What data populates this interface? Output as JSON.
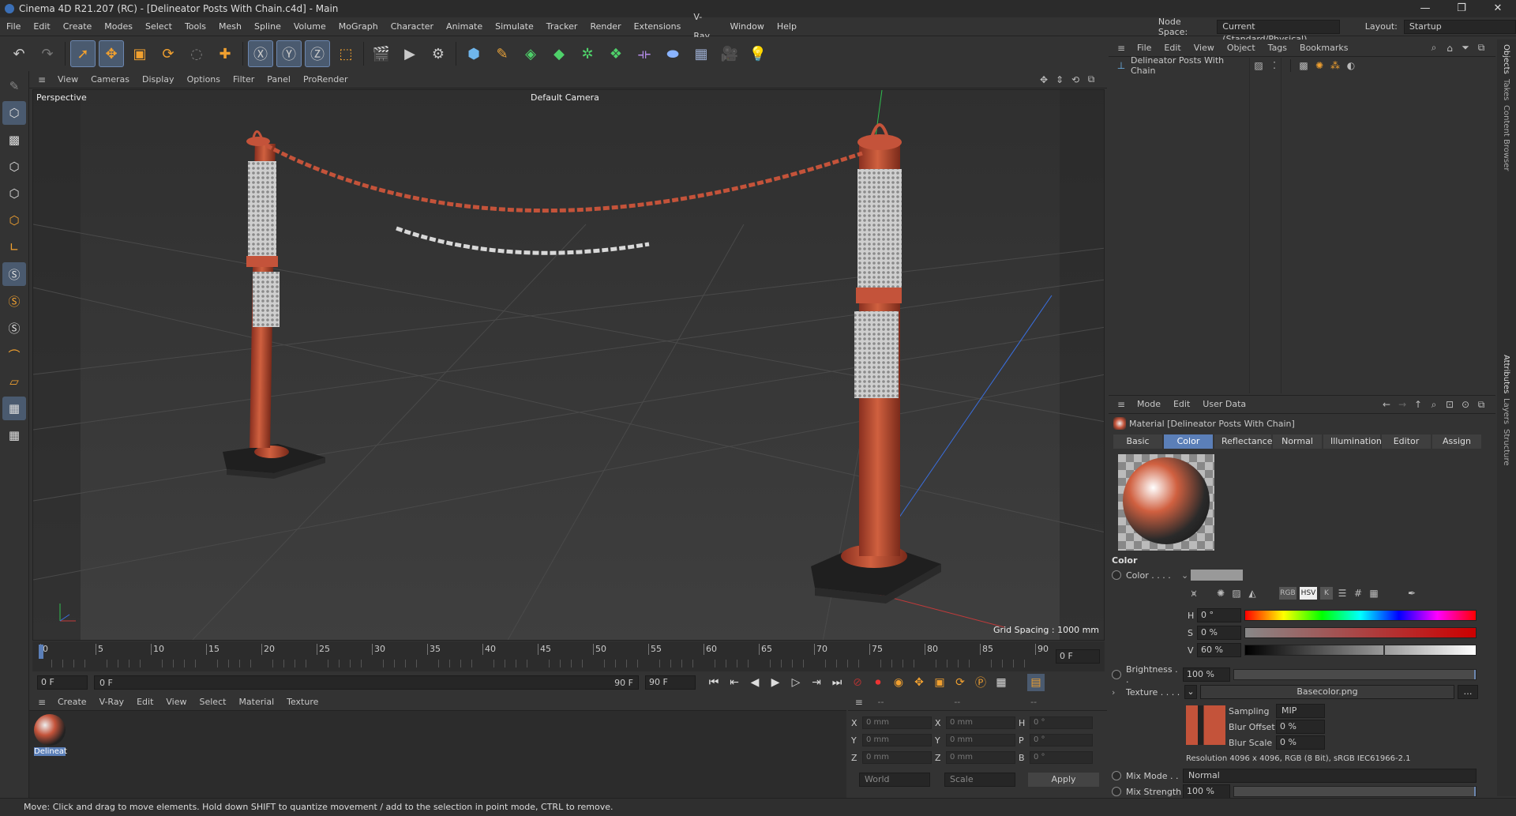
{
  "window": {
    "title": "Cinema 4D R21.207 (RC) - [Delineator Posts With Chain.c4d] - Main",
    "controls": [
      "—",
      "❐",
      "✕"
    ]
  },
  "menubar": {
    "items": [
      "File",
      "Edit",
      "Create",
      "Modes",
      "Select",
      "Tools",
      "Mesh",
      "Spline",
      "Volume",
      "MoGraph",
      "Character",
      "Animate",
      "Simulate",
      "Tracker",
      "Render",
      "Extensions",
      "V-Ray",
      "Window",
      "Help"
    ],
    "node_space_label": "Node Space:",
    "node_space_value": "Current (Standard/Physical)",
    "layout_label": "Layout:",
    "layout_value": "Startup"
  },
  "viewport": {
    "menu": [
      "View",
      "Cameras",
      "Display",
      "Options",
      "Filter",
      "Panel",
      "ProRender"
    ],
    "label": "Perspective",
    "camera": "Default Camera",
    "grid_spacing": "Grid Spacing : 1000 mm"
  },
  "timeline": {
    "ticks": [
      "0",
      "5",
      "10",
      "15",
      "20",
      "25",
      "30",
      "35",
      "40",
      "45",
      "50",
      "55",
      "60",
      "65",
      "70",
      "75",
      "80",
      "85",
      "90"
    ],
    "current_frame": "0 F",
    "start_field": "0 F",
    "range_start": "0 F",
    "range_end": "90 F",
    "end_field": "90 F"
  },
  "material_manager": {
    "menu": [
      "Create",
      "V-Ray",
      "Edit",
      "View",
      "Select",
      "Material",
      "Texture"
    ],
    "material_name": "Delineat"
  },
  "coordinates": {
    "header": [
      "--",
      "--",
      "--"
    ],
    "rows": [
      {
        "a": "X",
        "av": "0 mm",
        "b": "X",
        "bv": "0 mm",
        "c": "H",
        "cv": "0 °"
      },
      {
        "a": "Y",
        "av": "0 mm",
        "b": "Y",
        "bv": "0 mm",
        "c": "P",
        "cv": "0 °"
      },
      {
        "a": "Z",
        "av": "0 mm",
        "b": "Z",
        "bv": "0 mm",
        "c": "B",
        "cv": "0 °"
      }
    ],
    "mode1": "World",
    "mode2": "Scale",
    "apply": "Apply"
  },
  "object_manager": {
    "menu": [
      "File",
      "Edit",
      "View",
      "Object",
      "Tags",
      "Bookmarks"
    ],
    "object_name": "Delineator Posts With Chain"
  },
  "right_tabs": {
    "top": [
      "Objects",
      "Takes",
      "Content Browser"
    ],
    "bottom": [
      "Attributes",
      "Layers",
      "Structure"
    ]
  },
  "attributes": {
    "menu": [
      "Mode",
      "Edit",
      "User Data"
    ],
    "title": "Material [Delineator Posts With Chain]",
    "tabs": [
      "Basic",
      "Color",
      "Reflectance",
      "Normal",
      "Illumination",
      "Editor",
      "Assign"
    ],
    "active_tab": "Color",
    "section": "Color",
    "color_label": "Color . . . .",
    "picker_modes": [
      "RGB",
      "HSV",
      "K"
    ],
    "h_label": "H",
    "h_value": "0 °",
    "s_label": "S",
    "s_value": "0 %",
    "v_label": "V",
    "v_value": "60 %",
    "brightness_label": "Brightness . .",
    "brightness_value": "100 %",
    "texture_label": "Texture . . . .",
    "texture_file": "Basecolor.png",
    "sampling_label": "Sampling",
    "sampling_value": "MIP",
    "blur_offset_label": "Blur Offset",
    "blur_offset_value": "0 %",
    "blur_scale_label": "Blur Scale",
    "blur_scale_value": "0 %",
    "resolution": "Resolution 4096 x 4096, RGB (8 Bit), sRGB IEC61966-2.1",
    "mix_mode_label": "Mix Mode . .",
    "mix_mode_value": "Normal",
    "mix_strength_label": "Mix Strength",
    "mix_strength_value": "100 %",
    "brightness_fill": 1.0,
    "mix_strength_fill": 1.0,
    "v_fill": 0.6
  },
  "status": "Move: Click and drag to move elements. Hold down SHIFT to quantize movement / add to the selection in point mode, CTRL to remove.",
  "colors": {
    "accent": "#5b7fb8",
    "post_orange": "#c4533a",
    "background": "#333333"
  }
}
